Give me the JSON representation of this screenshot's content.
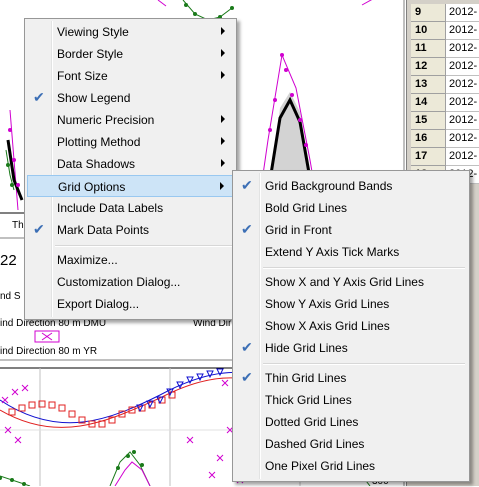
{
  "background": {
    "panel_number": "22",
    "label_speed": "nd S",
    "label_th": "Th",
    "label_dmu": "ind Direction 80 m DMU",
    "label_dir_right": "Wind Dir",
    "label_yr": "ind Direction 80 m YR",
    "axis_bottom_value": "300",
    "colors": {
      "magenta": "#d000d0",
      "green_dot": "#1a7a1a",
      "blue": "#1010d0",
      "red": "#e02020",
      "black": "#000000"
    }
  },
  "grid_rows": [
    {
      "row": "9",
      "value": "2012-"
    },
    {
      "row": "10",
      "value": "2012-"
    },
    {
      "row": "11",
      "value": "2012-"
    },
    {
      "row": "12",
      "value": "2012-"
    },
    {
      "row": "13",
      "value": "2012-"
    },
    {
      "row": "14",
      "value": "2012-"
    },
    {
      "row": "15",
      "value": "2012-"
    },
    {
      "row": "16",
      "value": "2012-"
    },
    {
      "row": "17",
      "value": "2012-"
    },
    {
      "row": "18",
      "value": "2012-"
    }
  ],
  "main_menu": {
    "items": [
      {
        "label": "Viewing Style",
        "submenu": true,
        "checked": false
      },
      {
        "label": "Border Style",
        "submenu": true,
        "checked": false
      },
      {
        "label": "Font Size",
        "submenu": true,
        "checked": false
      },
      {
        "label": "Show Legend",
        "submenu": false,
        "checked": true
      },
      {
        "label": "Numeric Precision",
        "submenu": true,
        "checked": false
      },
      {
        "label": "Plotting Method",
        "submenu": true,
        "checked": false
      },
      {
        "label": "Data Shadows",
        "submenu": true,
        "checked": false
      },
      {
        "label": "Grid Options",
        "submenu": true,
        "checked": false,
        "highlighted": true
      },
      {
        "label": "Include Data Labels",
        "submenu": false,
        "checked": false
      },
      {
        "label": "Mark Data Points",
        "submenu": false,
        "checked": true
      },
      {
        "label": "Maximize...",
        "submenu": false,
        "checked": false
      },
      {
        "label": "Customization Dialog...",
        "submenu": false,
        "checked": false
      },
      {
        "label": "Export Dialog...",
        "submenu": false,
        "checked": false
      }
    ]
  },
  "grid_menu": {
    "items": [
      {
        "label": "Grid Background Bands",
        "checked": true
      },
      {
        "label": "Bold Grid Lines",
        "checked": false
      },
      {
        "label": "Grid in Front",
        "checked": true
      },
      {
        "label": "Extend Y Axis Tick Marks",
        "checked": false
      },
      {
        "label": "Show X and Y Axis Grid Lines",
        "checked": false
      },
      {
        "label": "Show Y Axis Grid Lines",
        "checked": false
      },
      {
        "label": "Show X Axis Grid Lines",
        "checked": false
      },
      {
        "label": "Hide Grid Lines",
        "checked": true
      },
      {
        "label": "Thin Grid Lines",
        "checked": true
      },
      {
        "label": "Thick Grid Lines",
        "checked": false
      },
      {
        "label": "Dotted Grid Lines",
        "checked": false
      },
      {
        "label": "Dashed Grid Lines",
        "checked": false
      },
      {
        "label": "One Pixel Grid Lines",
        "checked": false
      }
    ]
  }
}
